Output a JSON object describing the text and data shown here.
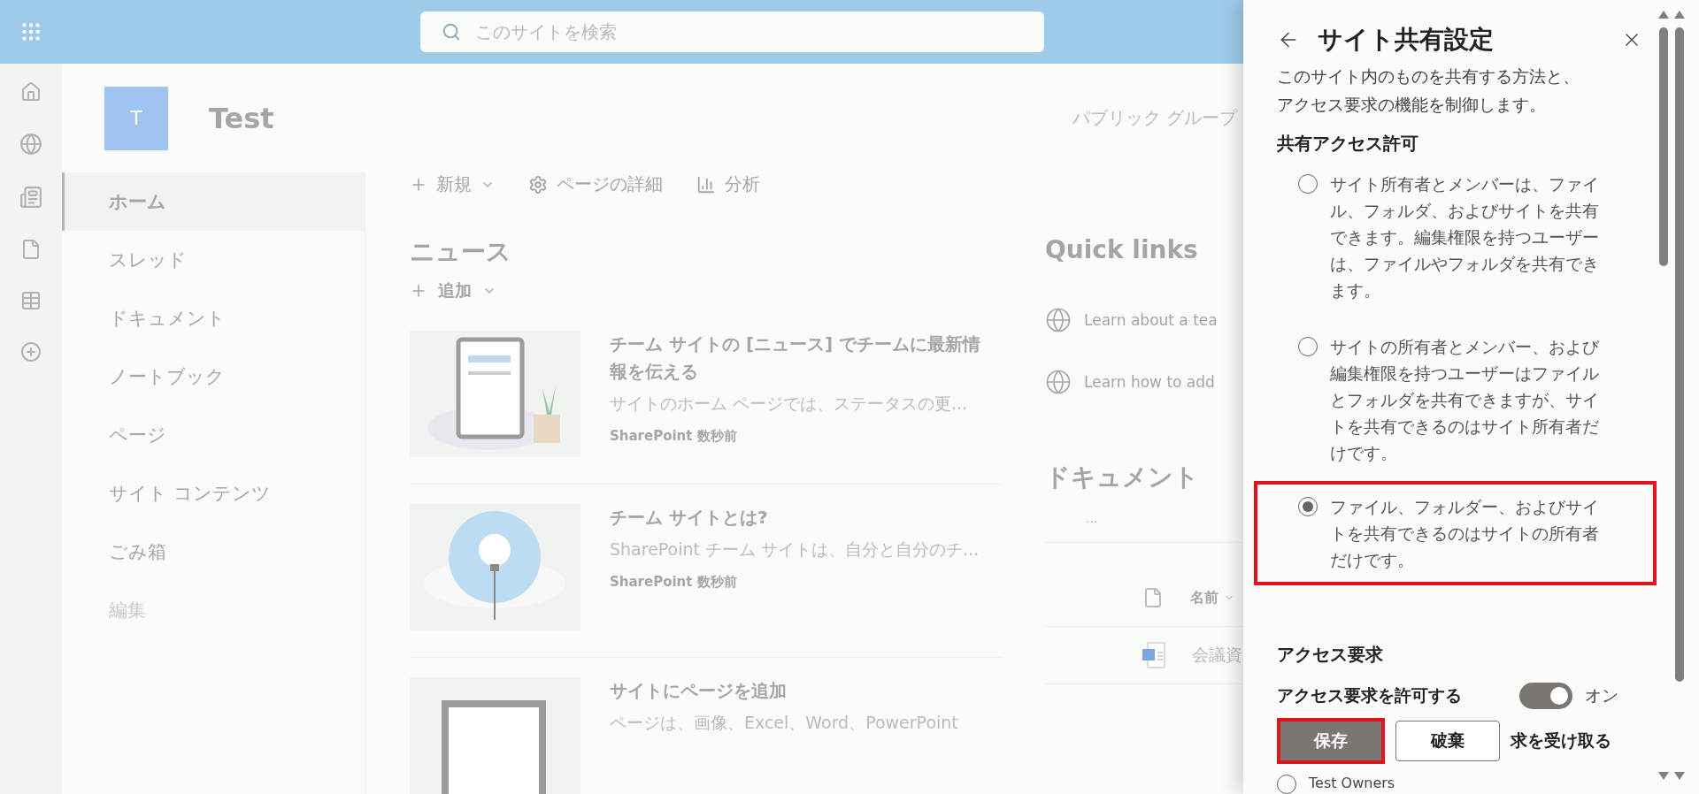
{
  "app_bar": {
    "search": {
      "placeholder": "このサイトを検索"
    }
  },
  "site": {
    "logo_letter": "T",
    "title": "Test",
    "privacy": "パブリック グループ"
  },
  "nav": [
    {
      "label": "ホーム",
      "kind": "link",
      "selected": true
    },
    {
      "label": "スレッド",
      "kind": "link",
      "selected": false
    },
    {
      "label": "ドキュメント",
      "kind": "link",
      "selected": false
    },
    {
      "label": "ノートブック",
      "kind": "link",
      "selected": false
    },
    {
      "label": "ページ",
      "kind": "link",
      "selected": false
    },
    {
      "label": "サイト コンテンツ",
      "kind": "link",
      "selected": false
    },
    {
      "label": "ごみ箱",
      "kind": "link",
      "selected": false
    },
    {
      "label": "編集",
      "kind": "edit",
      "selected": false
    }
  ],
  "command_bar": [
    {
      "label": "新規",
      "kind": "new"
    },
    {
      "label": "ページの詳細",
      "kind": "details"
    },
    {
      "label": "分析",
      "kind": "analytics"
    }
  ],
  "news": {
    "title": "ニュース",
    "add": "追加",
    "items": [
      {
        "kind": "tablet",
        "title": "チーム サイトの [ニュース] でチームに最新情報を伝える",
        "description": "サイトのホーム ページでは、ステータスの更...",
        "source": "SharePoint",
        "time": "数秒前"
      },
      {
        "kind": "bulb",
        "title": "チーム サイトとは?",
        "description": "SharePoint チーム サイトは、自分と自分のチ...",
        "source": "SharePoint",
        "time": "数秒前"
      },
      {
        "kind": "monitor",
        "title": "サイトにページを追加",
        "description": "ページは、画像、Excel、Word、PowerPoint"
      }
    ]
  },
  "quick_links": {
    "title": "Quick links",
    "items": [
      "Learn about a tea",
      "Learn how to add"
    ]
  },
  "documents": {
    "title": "ドキュメント",
    "more": "...",
    "column": "名前",
    "files": [
      "会議資"
    ]
  },
  "panel": {
    "title": "サイト共有設定",
    "description": "このサイト内のものを共有する方法と、アクセス要求の機能を制御します。",
    "sharing": {
      "heading": "共有アクセス許可",
      "options": [
        {
          "label": "サイト所有者とメンバーは、ファイル、フォルダ、およびサイトを共有できます。編集権限を持つユーザーは、ファイルやフォルダを共有できます。",
          "selected": false,
          "highlighted": false
        },
        {
          "label": "サイトの所有者とメンバー、および編集権限を持つユーザーはファイルとフォルダを共有できますが、サイトを共有できるのはサイト所有者だけです。",
          "selected": false,
          "highlighted": false
        },
        {
          "label": "ファイル、フォルダー、およびサイトを共有できるのはサイトの所有者だけです。",
          "selected": true,
          "highlighted": true
        }
      ]
    },
    "access": {
      "heading": "アクセス要求",
      "toggle": {
        "label": "アクセス要求を許可する",
        "on": true,
        "state_text": "オン"
      },
      "receiver_text": "求を受け取る",
      "receivers": [
        {
          "label": "Test Owners",
          "selected": false
        }
      ]
    },
    "buttons": [
      {
        "label": "保存",
        "kind": "primary",
        "highlighted": true
      },
      {
        "label": "破棄",
        "kind": "secondary",
        "highlighted": false
      }
    ]
  }
}
